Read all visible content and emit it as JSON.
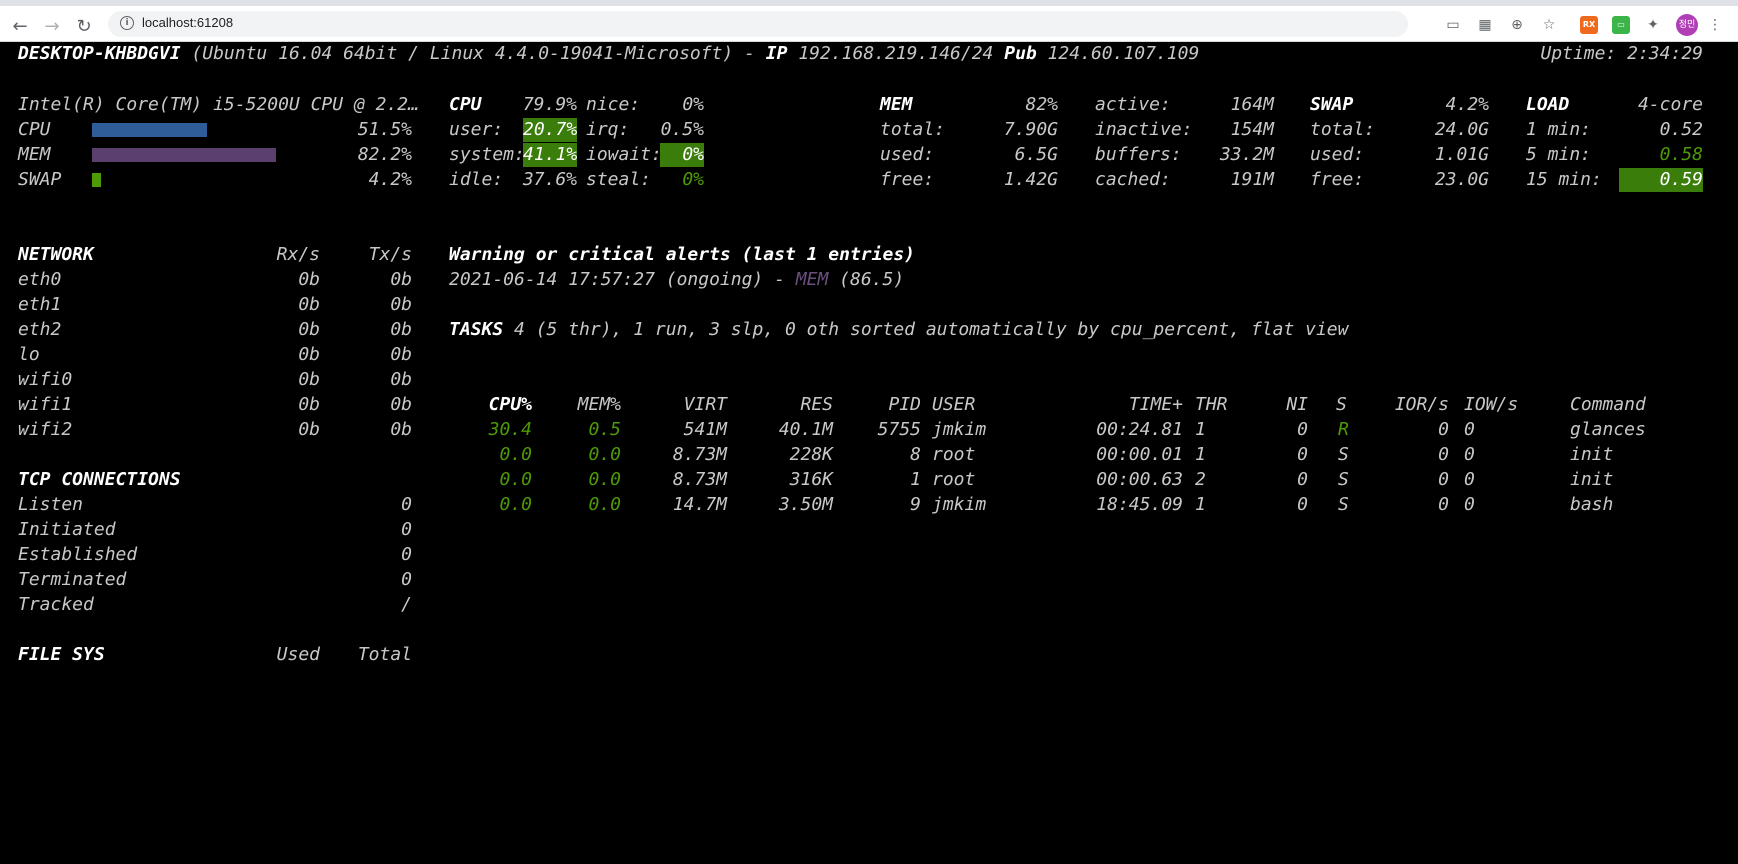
{
  "browser": {
    "url": "localhost:61208",
    "avatar_text": "정민",
    "ext1": "RX",
    "ext2": "▭",
    "colors": {
      "ext1": "#f06a1d",
      "ext2": "#3bb54a",
      "avatar": "#b03fb6"
    }
  },
  "header": {
    "hostname": "DESKTOP-KHBDGVI",
    "os": "(Ubuntu 16.04 64bit / Linux 4.4.0-19041-Microsoft) -",
    "ip_label": "IP",
    "ip": "192.168.219.146/24",
    "pub_label": "Pub",
    "pub": "124.60.107.109",
    "uptime": "Uptime: 2:34:29"
  },
  "quicklook": {
    "cpu_name": "Intel(R) Core(TM) i5-5200U CPU @ 2.2…",
    "rows": [
      {
        "label": "CPU",
        "value": "51.5%",
        "fraction": 0.515,
        "color": "#2f5d9a"
      },
      {
        "label": "MEM",
        "value": "82.2%",
        "fraction": 0.822,
        "color": "#5a3f6f"
      },
      {
        "label": "SWAP",
        "value": "4.2%",
        "fraction": 0.042,
        "color": "#4e9a06"
      }
    ]
  },
  "cpu": {
    "title": "CPU",
    "total": "79.9%",
    "user_label": "user:",
    "user": "20.7%",
    "system_label": "system:",
    "system": "41.1%",
    "idle_label": "idle:",
    "idle": "37.6%",
    "nice_label": "nice:",
    "nice": "0%",
    "irq_label": "irq:",
    "irq": "0.5%",
    "iowait_label": "iowait:",
    "iowait": "0%",
    "steal_label": "steal:",
    "steal": "0%"
  },
  "mem": {
    "title": "MEM",
    "percent": "82%",
    "total_label": "total:",
    "total": "7.90G",
    "used_label": "used:",
    "used": "6.5G",
    "free_label": "free:",
    "free": "1.42G",
    "active_label": "active:",
    "active": "164M",
    "inactive_label": "inactive:",
    "inactive": "154M",
    "buffers_label": "buffers:",
    "buffers": "33.2M",
    "cached_label": "cached:",
    "cached": "191M"
  },
  "swap": {
    "title": "SWAP",
    "percent": "4.2%",
    "total_label": "total:",
    "total": "24.0G",
    "used_label": "used:",
    "used": "1.01G",
    "free_label": "free:",
    "free": "23.0G"
  },
  "load": {
    "title": "LOAD",
    "cores": "4-core",
    "min1_label": "1 min:",
    "min1": "0.52",
    "min5_label": "5 min:",
    "min5": "0.58",
    "min15_label": "15 min:",
    "min15": "0.59"
  },
  "network": {
    "title": "NETWORK",
    "rx_header": "Rx/s",
    "tx_header": "Tx/s",
    "rows": [
      {
        "iface": "eth0",
        "rx": "0b",
        "tx": "0b"
      },
      {
        "iface": "eth1",
        "rx": "0b",
        "tx": "0b"
      },
      {
        "iface": "eth2",
        "rx": "0b",
        "tx": "0b"
      },
      {
        "iface": "lo",
        "rx": "0b",
        "tx": "0b"
      },
      {
        "iface": "wifi0",
        "rx": "0b",
        "tx": "0b"
      },
      {
        "iface": "wifi1",
        "rx": "0b",
        "tx": "0b"
      },
      {
        "iface": "wifi2",
        "rx": "0b",
        "tx": "0b"
      }
    ]
  },
  "tcp": {
    "title": "TCP CONNECTIONS",
    "rows": [
      {
        "label": "Listen",
        "value": "0"
      },
      {
        "label": "Initiated",
        "value": "0"
      },
      {
        "label": "Established",
        "value": "0"
      },
      {
        "label": "Terminated",
        "value": "0"
      },
      {
        "label": "Tracked",
        "value": "/"
      }
    ]
  },
  "filesys": {
    "title": "FILE SYS",
    "used_header": "Used",
    "total_header": "Total"
  },
  "alerts": {
    "title": "Warning or critical alerts (last 1 entries)",
    "entry_prefix": "2021-06-14 17:57:27 (ongoing) -",
    "entry_type": "MEM",
    "entry_value": "(86.5)"
  },
  "tasks": {
    "label": "TASKS",
    "summary": "4 (5 thr), 1 run, 3 slp, 0 oth sorted automatically by cpu_percent, flat view"
  },
  "processes": {
    "headers": {
      "cpu": "CPU%",
      "mem": "MEM%",
      "virt": "VIRT",
      "res": "RES",
      "pid": "PID",
      "user": "USER",
      "time": "TIME+",
      "thr": "THR",
      "ni": "NI",
      "s": "S",
      "ior": "IOR/s",
      "iow": "IOW/s",
      "cmd": "Command"
    },
    "rows": [
      {
        "cpu": "30.4",
        "mem": "0.5",
        "virt": "541M",
        "res": "40.1M",
        "pid": "5755",
        "user": "jmkim",
        "time": "00:24.81",
        "thr": "1",
        "ni": "0",
        "s": "R",
        "ior": "0",
        "iow": "0",
        "cmd": "glances"
      },
      {
        "cpu": "0.0",
        "mem": "0.0",
        "virt": "8.73M",
        "res": "228K",
        "pid": "8",
        "user": "root",
        "time": "00:00.01",
        "thr": "1",
        "ni": "0",
        "s": "S",
        "ior": "0",
        "iow": "0",
        "cmd": "init"
      },
      {
        "cpu": "0.0",
        "mem": "0.0",
        "virt": "8.73M",
        "res": "316K",
        "pid": "1",
        "user": "root",
        "time": "00:00.63",
        "thr": "2",
        "ni": "0",
        "s": "S",
        "ior": "0",
        "iow": "0",
        "cmd": "init"
      },
      {
        "cpu": "0.0",
        "mem": "0.0",
        "virt": "14.7M",
        "res": "3.50M",
        "pid": "9",
        "user": "jmkim",
        "time": "18:45.09",
        "thr": "1",
        "ni": "0",
        "s": "S",
        "ior": "0",
        "iow": "0",
        "cmd": "bash"
      }
    ]
  }
}
